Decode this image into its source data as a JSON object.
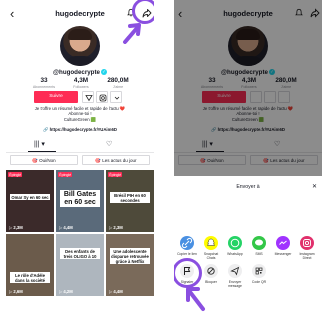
{
  "profile": {
    "username": "hugodecrypte",
    "handle": "@hugodecrypte",
    "stats": [
      {
        "value": "33",
        "label": "Abonnements"
      },
      {
        "value": "4,3M",
        "label": "Followers"
      },
      {
        "value": "280,0M",
        "label": "J'aime"
      }
    ],
    "follow_label": "Suivre",
    "bio_lines": [
      "Je t'offre un résumé facile et rapide de l'actu ❤️",
      "Abonne-toi !",
      "CultureGreen 🟩"
    ],
    "link": "https://hugodecrypte.fr/#UAim6D",
    "tabs": [
      "|||",
      "♡"
    ],
    "chips": [
      "Oui/Non",
      "Les actus du jour"
    ]
  },
  "videos": [
    {
      "pin": "Épinglé",
      "caption": "Omar Sy en 60 sec",
      "views": "2,3M",
      "color": "#3b2a2a"
    },
    {
      "pin": "Épinglé",
      "caption": "Bill Gates en 60 sec",
      "views": "4,4M",
      "color": "#5a6a7a"
    },
    {
      "pin": "Épinglé",
      "caption": "Brésil PIH en 60 secondes",
      "views": "2,3M",
      "color": "#4e4a3a"
    },
    {
      "pin": "",
      "caption": "Le rôle d'Adèle dans la société",
      "views": "2,6M",
      "color": "#6b5b4b"
    },
    {
      "pin": "",
      "caption": "Des enfants de treis OLIGO à 10",
      "views": "4,2M",
      "color": "#aeb6be"
    },
    {
      "pin": "",
      "caption": "Une adolescente disparue retrouvée grâce à Netflix",
      "views": "4,4M",
      "color": "#7a6a5a"
    }
  ],
  "share_sheet": {
    "title": "Envoyer à",
    "close": "✕",
    "row1": [
      {
        "label": "Copier le lien",
        "icon": "link-icon",
        "color": "#4a90e2"
      },
      {
        "label": "Snapchat Chats",
        "icon": "snapchat-icon",
        "color": "#fffc00"
      },
      {
        "label": "WhatsApp",
        "icon": "whatsapp-icon",
        "color": "#25d366"
      },
      {
        "label": "SMS",
        "icon": "sms-icon",
        "color": "#33c748"
      },
      {
        "label": "Messenger",
        "icon": "messenger-icon",
        "color": "#a033ff"
      },
      {
        "label": "Instagram Direct",
        "icon": "instagram-icon",
        "color": "#e1306c"
      }
    ],
    "row2": [
      {
        "label": "Signaler",
        "icon": "flag-icon"
      },
      {
        "label": "Bloquer",
        "icon": "block-icon"
      },
      {
        "label": "Envoyer message",
        "icon": "send-message-icon"
      },
      {
        "label": "Code QR",
        "icon": "qr-code-icon"
      }
    ]
  },
  "accent": "#fe2c55",
  "annotation_color": "#8a4fe0"
}
